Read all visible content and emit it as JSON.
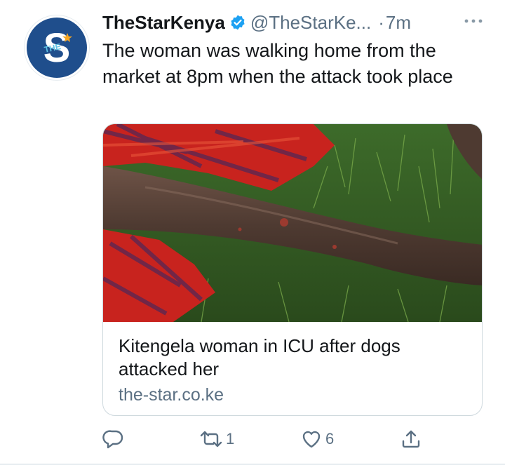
{
  "tweet": {
    "author_name": "TheStarKenya",
    "author_handle": "@TheStarKe...",
    "separator": "·",
    "time": "7m",
    "text": "The woman was walking home from the market at 8pm when the attack took place",
    "avatar": {
      "letter": "S",
      "small_text": "THE"
    }
  },
  "card": {
    "title": "Kitengela woman in ICU after dogs attacked her",
    "domain": "the-star.co.ke"
  },
  "actions": {
    "reply_count": "",
    "retweet_count": "1",
    "like_count": "6"
  },
  "colors": {
    "text_primary": "#14171a",
    "text_secondary": "#5b7083",
    "verified_blue": "#1da1f2",
    "avatar_blue": "#1f4e8c",
    "avatar_star": "#f5a623"
  }
}
